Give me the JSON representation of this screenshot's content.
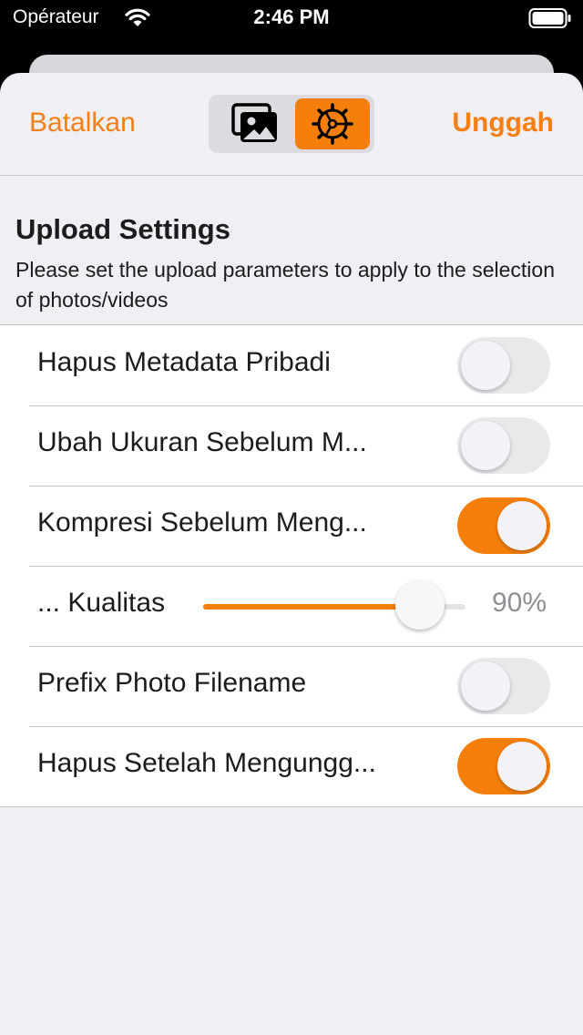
{
  "status_bar": {
    "carrier": "Opérateur",
    "time": "2:46 PM"
  },
  "navbar": {
    "cancel_label": "Batalkan",
    "upload_label": "Unggah",
    "segments": [
      "photos",
      "settings"
    ],
    "selected_segment": "settings",
    "accent_color": "#F57F0A"
  },
  "section": {
    "title": "Upload Settings",
    "description": "Please set the upload parameters to apply to the selection of photos/videos"
  },
  "settings": {
    "strip_metadata": {
      "label": "Hapus Metadata Pribadi",
      "on": false
    },
    "resize": {
      "label": "Ubah Ukuran Sebelum M...",
      "on": false
    },
    "compress": {
      "label": "Kompresi Sebelum Meng...",
      "on": true
    },
    "quality": {
      "label": "... Kualitas",
      "value_text": "90%",
      "fraction": 0.9
    },
    "prefix_filename": {
      "label": "Prefix Photo Filename",
      "on": false
    },
    "delete_after": {
      "label": "Hapus Setelah Mengungg...",
      "on": true
    }
  }
}
